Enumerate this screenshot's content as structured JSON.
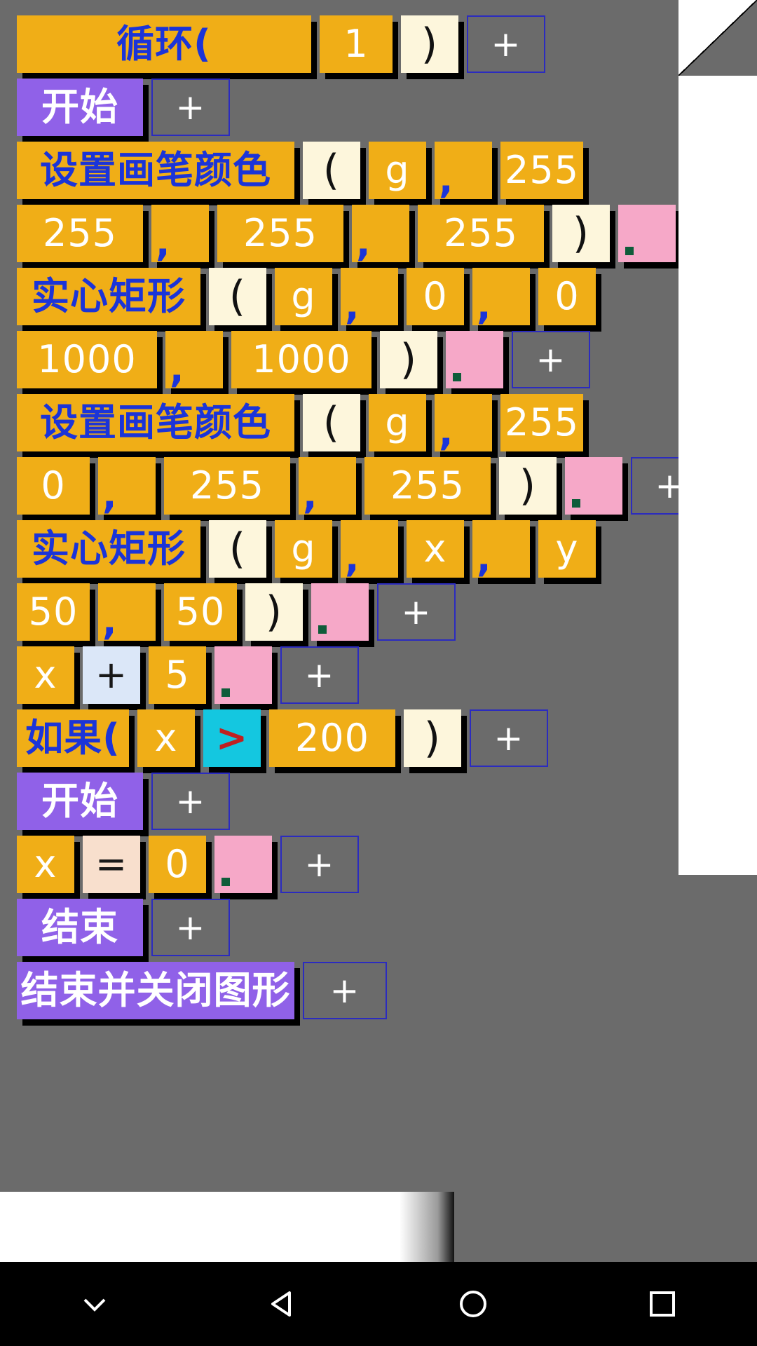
{
  "app": {
    "type": "block-based-visual-programming-editor",
    "background_color": "#6b6b6b",
    "block_colors": {
      "keyword": "#f0ae17",
      "value": "#f0ae17",
      "paren": "#fdf6dc",
      "control": "#9061e8",
      "statement_end": "#f6a8c8",
      "comparison": "#14c7e0",
      "operator": "#dbe7f8",
      "assign": "#f8dfcd",
      "empty_slot_border": "#2b2bbf"
    }
  },
  "program": {
    "rows": [
      {
        "id": "row-loop",
        "blocks": [
          {
            "text": "循环(",
            "kind": "keyword"
          },
          {
            "text": "1",
            "kind": "value"
          },
          {
            "text": ")",
            "kind": "paren"
          },
          {
            "text": "+",
            "kind": "slot"
          }
        ]
      },
      {
        "id": "row-begin-1",
        "blocks": [
          {
            "text": "开始",
            "kind": "control"
          },
          {
            "text": "+",
            "kind": "slot"
          }
        ]
      },
      {
        "id": "row-setpencolor-1",
        "blocks": [
          {
            "text": "设置画笔颜色",
            "kind": "keyword"
          },
          {
            "text": "(",
            "kind": "paren"
          },
          {
            "text": "g",
            "kind": "value"
          },
          {
            "text": ",",
            "kind": "comma"
          },
          {
            "text": "255",
            "kind": "value"
          }
        ]
      },
      {
        "id": "row-setpencolor-1-args",
        "blocks": [
          {
            "text": "255",
            "kind": "value"
          },
          {
            "text": ",",
            "kind": "comma"
          },
          {
            "text": "255",
            "kind": "value"
          },
          {
            "text": ",",
            "kind": "comma"
          },
          {
            "text": "255",
            "kind": "value"
          },
          {
            "text": ")",
            "kind": "paren"
          },
          {
            "text": "",
            "kind": "statement_end"
          }
        ]
      },
      {
        "id": "row-fillrect-1",
        "blocks": [
          {
            "text": "实心矩形",
            "kind": "keyword"
          },
          {
            "text": "(",
            "kind": "paren"
          },
          {
            "text": "g",
            "kind": "value"
          },
          {
            "text": ",",
            "kind": "comma"
          },
          {
            "text": "0",
            "kind": "value"
          },
          {
            "text": ",",
            "kind": "comma"
          },
          {
            "text": "0",
            "kind": "value"
          }
        ]
      },
      {
        "id": "row-fillrect-1-args",
        "blocks": [
          {
            "text": "1000",
            "kind": "value"
          },
          {
            "text": ",",
            "kind": "comma"
          },
          {
            "text": "1000",
            "kind": "value"
          },
          {
            "text": ")",
            "kind": "paren"
          },
          {
            "text": "",
            "kind": "statement_end"
          },
          {
            "text": "+",
            "kind": "slot"
          }
        ]
      },
      {
        "id": "row-setpencolor-2",
        "blocks": [
          {
            "text": "设置画笔颜色",
            "kind": "keyword"
          },
          {
            "text": "(",
            "kind": "paren"
          },
          {
            "text": "g",
            "kind": "value"
          },
          {
            "text": ",",
            "kind": "comma"
          },
          {
            "text": "255",
            "kind": "value"
          }
        ]
      },
      {
        "id": "row-setpencolor-2-args",
        "blocks": [
          {
            "text": "0",
            "kind": "value"
          },
          {
            "text": ",",
            "kind": "comma"
          },
          {
            "text": "255",
            "kind": "value"
          },
          {
            "text": ",",
            "kind": "comma"
          },
          {
            "text": "255",
            "kind": "value"
          },
          {
            "text": ")",
            "kind": "paren"
          },
          {
            "text": "",
            "kind": "statement_end"
          },
          {
            "text": "+",
            "kind": "slot"
          }
        ]
      },
      {
        "id": "row-fillrect-2",
        "blocks": [
          {
            "text": "实心矩形",
            "kind": "keyword"
          },
          {
            "text": "(",
            "kind": "paren"
          },
          {
            "text": "g",
            "kind": "value"
          },
          {
            "text": ",",
            "kind": "comma"
          },
          {
            "text": "x",
            "kind": "value"
          },
          {
            "text": ",",
            "kind": "comma"
          },
          {
            "text": "y",
            "kind": "value"
          }
        ]
      },
      {
        "id": "row-fillrect-2-args",
        "blocks": [
          {
            "text": "50",
            "kind": "value"
          },
          {
            "text": ",",
            "kind": "comma"
          },
          {
            "text": "50",
            "kind": "value"
          },
          {
            "text": ")",
            "kind": "paren"
          },
          {
            "text": "",
            "kind": "statement_end"
          },
          {
            "text": "+",
            "kind": "slot"
          }
        ]
      },
      {
        "id": "row-x-plus-5",
        "blocks": [
          {
            "text": "x",
            "kind": "value"
          },
          {
            "text": "+",
            "kind": "operator"
          },
          {
            "text": "5",
            "kind": "value"
          },
          {
            "text": "",
            "kind": "statement_end"
          },
          {
            "text": "+",
            "kind": "slot"
          }
        ]
      },
      {
        "id": "row-if",
        "blocks": [
          {
            "text": "如果(",
            "kind": "keyword"
          },
          {
            "text": "x",
            "kind": "value"
          },
          {
            "text": ">",
            "kind": "comparison"
          },
          {
            "text": "200",
            "kind": "value"
          },
          {
            "text": ")",
            "kind": "paren"
          },
          {
            "text": "+",
            "kind": "slot"
          }
        ]
      },
      {
        "id": "row-begin-2",
        "blocks": [
          {
            "text": "开始",
            "kind": "control"
          },
          {
            "text": "+",
            "kind": "slot"
          }
        ]
      },
      {
        "id": "row-x-assign-0",
        "blocks": [
          {
            "text": "x",
            "kind": "value"
          },
          {
            "text": "=",
            "kind": "assign"
          },
          {
            "text": "0",
            "kind": "value"
          },
          {
            "text": "",
            "kind": "statement_end"
          },
          {
            "text": "+",
            "kind": "slot"
          }
        ]
      },
      {
        "id": "row-end",
        "blocks": [
          {
            "text": "结束",
            "kind": "control"
          },
          {
            "text": "+",
            "kind": "slot"
          }
        ]
      },
      {
        "id": "row-partial-bottom",
        "blocks": [
          {
            "text": "结束并关闭图形",
            "kind": "control"
          },
          {
            "text": "+",
            "kind": "slot"
          }
        ]
      }
    ]
  },
  "navbar": {
    "items": [
      {
        "name": "hide-keyboard",
        "glyph": "chevron-down"
      },
      {
        "name": "back",
        "glyph": "triangle-left"
      },
      {
        "name": "home",
        "glyph": "circle"
      },
      {
        "name": "recents",
        "glyph": "square"
      }
    ]
  }
}
